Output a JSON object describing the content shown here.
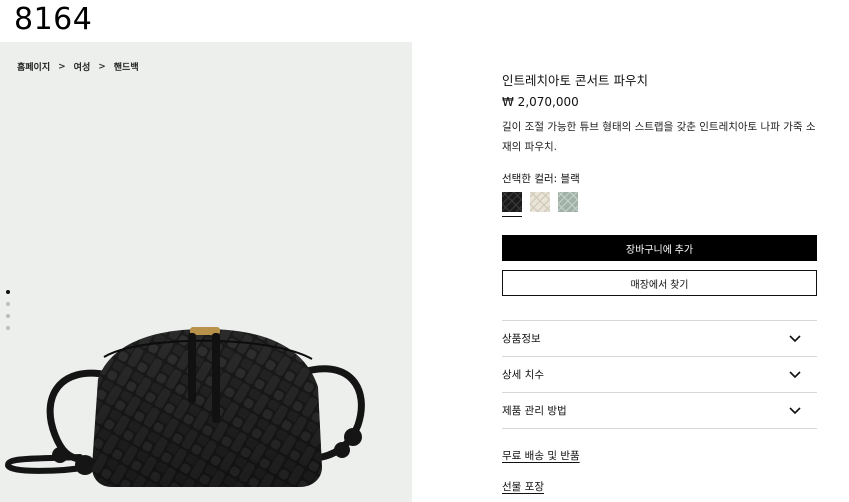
{
  "page": {
    "id_label": "8164"
  },
  "breadcrumb": {
    "items": [
      "홈페이지",
      "여성",
      "핸드백"
    ],
    "separator": ">"
  },
  "gallery": {
    "image_count": 4,
    "active_index": 0
  },
  "product": {
    "title": "인트레치아토 콘서트 파우치",
    "price": "₩ 2,070,000",
    "description": "길이 조절 가능한 튜브 형태의 스트랩을 갖춘 인트레치아토 나파 가죽 소재의 파우치.",
    "color_label": "선택한 컬러: 블랙",
    "swatches": [
      {
        "name": "블랙",
        "color": "#1a1a1a",
        "selected": true
      },
      {
        "name": "크림",
        "color": "#e9e4d8",
        "selected": false
      },
      {
        "name": "세이지",
        "color": "#9fb0a6",
        "selected": false
      }
    ]
  },
  "actions": {
    "add_to_cart": "장바구니에 추가",
    "find_in_store": "매장에서 찾기"
  },
  "accordion": {
    "items": [
      "상품정보",
      "상세 치수",
      "제품 관리 방법"
    ]
  },
  "links": {
    "shipping": "무료 배송 및 반품",
    "gift": "선물 포장"
  }
}
